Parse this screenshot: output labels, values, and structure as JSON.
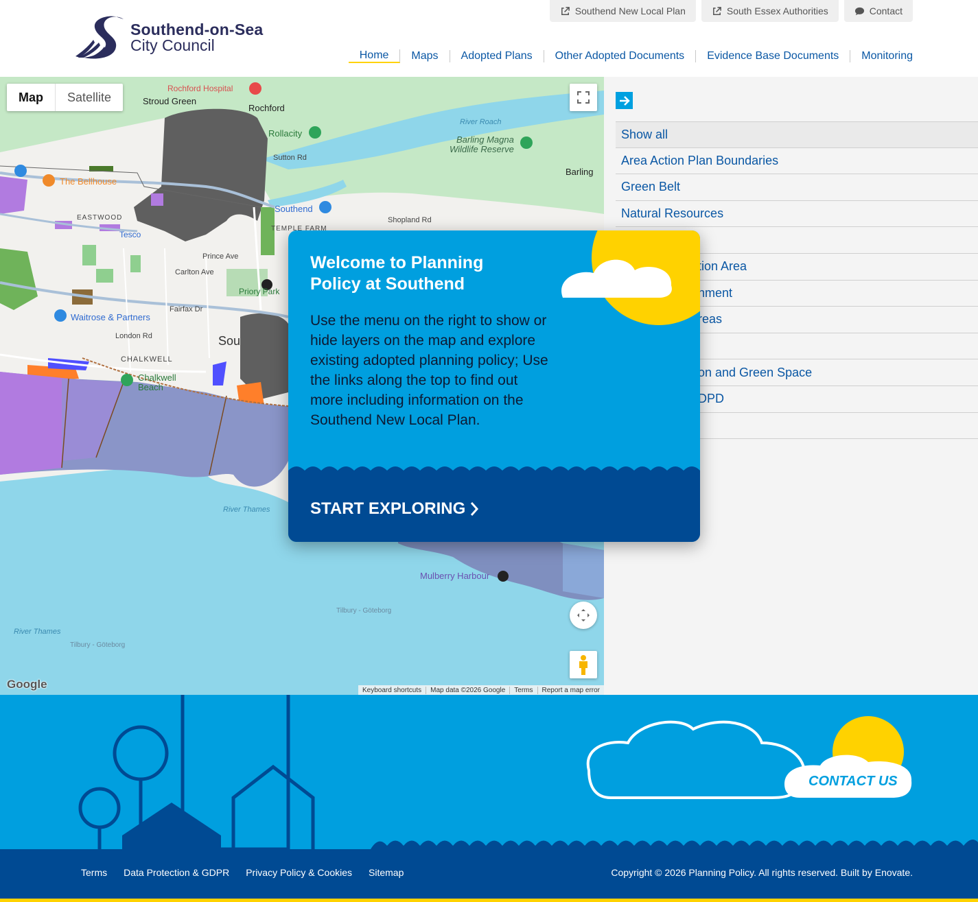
{
  "header": {
    "logo_line1": "Southend-on-Sea",
    "logo_line2": "City Council",
    "utility_links": [
      {
        "label": "Southend New Local Plan",
        "icon": "external-link-icon"
      },
      {
        "label": "South Essex Authorities",
        "icon": "external-link-icon"
      },
      {
        "label": "Contact",
        "icon": "speech-bubble-icon"
      }
    ],
    "nav": [
      {
        "label": "Home",
        "active": true
      },
      {
        "label": "Maps"
      },
      {
        "label": "Adopted Plans"
      },
      {
        "label": "Other Adopted Documents"
      },
      {
        "label": "Evidence Base Documents"
      },
      {
        "label": "Monitoring"
      }
    ]
  },
  "map": {
    "type_map": "Map",
    "type_satellite": "Satellite",
    "google": "Google",
    "attribution": [
      "Keyboard shortcuts",
      "Map data ©2026 Google",
      "Terms",
      "Report a map error"
    ],
    "labels": [
      "Rochford Hospital",
      "Stroud Green",
      "Rochford",
      "Rollacity",
      "River Roach",
      "Barling Magna",
      "Wildlife Reserve",
      "Barling",
      "Sutton Rd",
      "Shopland Rd",
      "The Bellhouse",
      "EASTWOOD",
      "Southend",
      "TEMPLE FARM",
      "Tesco",
      "Prince Ave",
      "Carlton Ave",
      "Priory Park",
      "Fairfax Dr",
      "Waitrose & Partners",
      "London Rd",
      "CHALKWELL",
      "Chalkwell",
      "Beach",
      "Sou",
      "River Thames",
      "Mulberry Harbour",
      "Tilbury - Göteborg"
    ],
    "colors": {
      "water": "#8fd6ea",
      "land": "#f2f1ee",
      "green": "#bfe6c2",
      "grey_area": "#5f5f5f",
      "purple": "#b17be0",
      "sea_zone": "#8a95c8"
    }
  },
  "sidebar": {
    "arrow_icon": "arrow-right-icon",
    "layers": [
      "Show all",
      "Area Action Plan Boundaries",
      "Green Belt",
      "Natural Resources",
      "",
      "tion Area",
      "nment",
      "reas",
      "",
      "on and Green Space",
      "DPD",
      ""
    ]
  },
  "modal": {
    "title": "Welcome to Planning Policy at Southend",
    "body": "Use the menu on the right to show or hide layers on the map and explore existing adopted planning policy; Use the links along the top to find out more including information on the Southend New Local Plan.",
    "cta": "START EXPLORING",
    "colors": {
      "bg": "#009fdf",
      "footer": "#004a93",
      "sun": "#ffd200"
    }
  },
  "footer": {
    "contact_us": "CONTACT US",
    "links": [
      "Terms",
      "Data Protection & GDPR",
      "Privacy Policy & Cookies",
      "Sitemap"
    ],
    "copyright": "Copyright © 2026 Planning Policy. All rights reserved. Built by Enovate."
  }
}
